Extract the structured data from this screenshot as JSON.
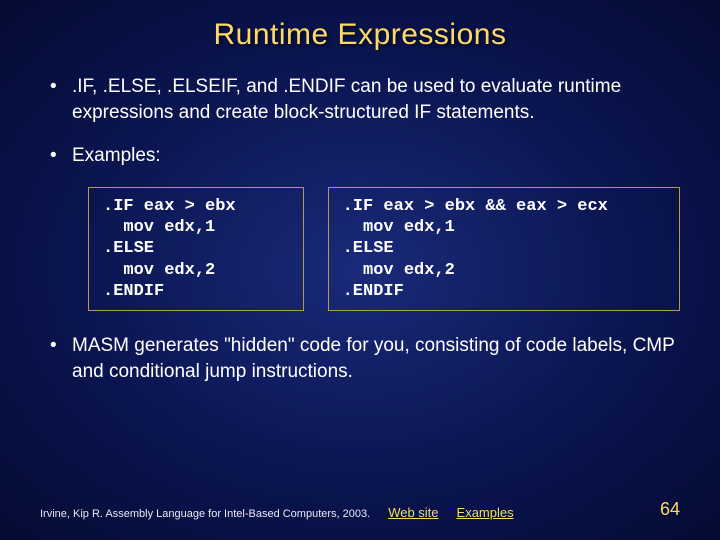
{
  "title": "Runtime Expressions",
  "bullets": {
    "b1": ".IF, .ELSE, .ELSEIF, and .ENDIF can be used to evaluate runtime expressions and create block-structured IF statements.",
    "b2": "Examples:",
    "b3": "MASM generates \"hidden\" code for you, consisting of code labels, CMP and conditional jump instructions."
  },
  "code": {
    "left": ".IF eax > ebx\n  mov edx,1\n.ELSE\n  mov edx,2\n.ENDIF",
    "right": ".IF eax > ebx && eax > ecx\n  mov edx,1\n.ELSE\n  mov edx,2\n.ENDIF"
  },
  "footer": {
    "citation": "Irvine, Kip R. Assembly Language for Intel-Based Computers, 2003.",
    "link1": "Web site",
    "link2": "Examples",
    "page": "64"
  }
}
